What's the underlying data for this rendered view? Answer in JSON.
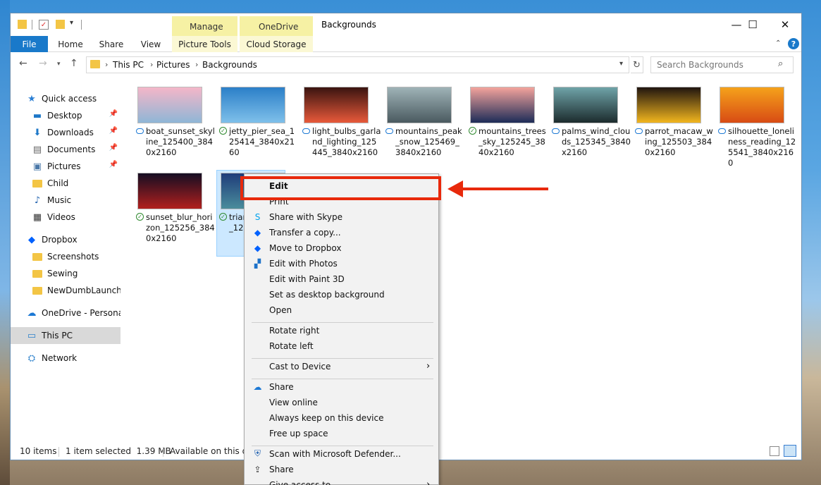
{
  "window": {
    "title": "Backgrounds",
    "min": "—",
    "max": "☐",
    "close": "✕"
  },
  "ribbon": {
    "contextual": [
      {
        "group": "Manage",
        "tab": "Picture Tools"
      },
      {
        "group": "OneDrive",
        "tab": "Cloud Storage"
      }
    ],
    "tabs": [
      "File",
      "Home",
      "Share",
      "View"
    ],
    "help": "?",
    "collapse": "⌃"
  },
  "address": {
    "crumbs": [
      "This PC",
      "Pictures",
      "Backgrounds"
    ],
    "search_placeholder": "Search Backgrounds"
  },
  "nav": [
    {
      "label": "Quick access",
      "icon": "star-icon",
      "pinned": false
    },
    {
      "label": "Desktop",
      "icon": "desktop-icon",
      "pinned": true
    },
    {
      "label": "Downloads",
      "icon": "download-icon",
      "pinned": true
    },
    {
      "label": "Documents",
      "icon": "document-icon",
      "pinned": true
    },
    {
      "label": "Pictures",
      "icon": "pictures-icon",
      "pinned": true
    },
    {
      "label": "Child",
      "icon": "folder-icon",
      "pinned": false
    },
    {
      "label": "Music",
      "icon": "music-icon",
      "pinned": false
    },
    {
      "label": "Videos",
      "icon": "video-icon",
      "pinned": false
    },
    {
      "label": "Dropbox",
      "icon": "dropbox-icon",
      "pinned": false
    },
    {
      "label": "Screenshots",
      "icon": "folder-icon",
      "pinned": false
    },
    {
      "label": "Sewing",
      "icon": "folder-icon",
      "pinned": false
    },
    {
      "label": "NewDumbLaunche",
      "icon": "folder-icon",
      "pinned": false
    },
    {
      "label": "OneDrive - Personal",
      "icon": "onedrive-icon",
      "pinned": false
    },
    {
      "label": "This PC",
      "icon": "pc-icon",
      "pinned": false
    },
    {
      "label": "Network",
      "icon": "network-icon",
      "pinned": false
    }
  ],
  "files": [
    {
      "name": "boat_sunset_skyline_125400_3840x2160",
      "status": "cloud",
      "colors": [
        "#f4b6c8",
        "#8fb6d6"
      ]
    },
    {
      "name": "jetty_pier_sea_125414_3840x2160",
      "status": "ok",
      "colors": [
        "#2b7fc8",
        "#7fc0ea"
      ]
    },
    {
      "name": "light_bulbs_garland_lighting_125445_3840x2160",
      "status": "cloud",
      "colors": [
        "#3a1410",
        "#e8593a"
      ]
    },
    {
      "name": "mountains_peak_snow_125469_3840x2160",
      "status": "cloud",
      "colors": [
        "#9fb3b7",
        "#4a5a60"
      ]
    },
    {
      "name": "mountains_trees_sky_125245_3840x2160",
      "status": "ok",
      "colors": [
        "#f4a39c",
        "#1d2c58"
      ]
    },
    {
      "name": "palms_wind_clouds_125345_3840x2160",
      "status": "cloud",
      "colors": [
        "#6fa3a8",
        "#1c2b2d"
      ]
    },
    {
      "name": "parrot_macaw_wing_125503_3840x2160",
      "status": "cloud",
      "colors": [
        "#20150f",
        "#f2b61e"
      ]
    },
    {
      "name": "silhouette_loneliness_reading_125541_3840x2160",
      "status": "cloud",
      "colors": [
        "#f5a21b",
        "#d84b14"
      ]
    },
    {
      "name": "sunset_blur_horizon_125256_3840x2160",
      "status": "ok",
      "colors": [
        "#150d22",
        "#b1201e"
      ]
    },
    {
      "name": "triangles_meteor_125_2160",
      "status": "ok",
      "colors": [
        "#1f3c7a",
        "#4a8d9c"
      ]
    }
  ],
  "status": {
    "count": "10 items",
    "selected": "1 item selected  1.39 MB",
    "availability": "Available on this dev"
  },
  "context_menu": [
    {
      "label": "Edit",
      "bold": true,
      "icon": ""
    },
    {
      "label": "Print",
      "icon": ""
    },
    {
      "label": "Share with Skype",
      "icon": "skype-icon"
    },
    {
      "label": "Transfer a copy...",
      "icon": "dropbox-icon"
    },
    {
      "label": "Move to Dropbox",
      "icon": "dropbox-icon"
    },
    {
      "label": "Edit with Photos",
      "icon": "photos-icon"
    },
    {
      "label": "Edit with Paint 3D",
      "icon": ""
    },
    {
      "label": "Set as desktop background",
      "icon": ""
    },
    {
      "label": "Open",
      "icon": ""
    },
    {
      "sep": true
    },
    {
      "label": "Rotate right",
      "icon": ""
    },
    {
      "label": "Rotate left",
      "icon": ""
    },
    {
      "sep": true
    },
    {
      "label": "Cast to Device",
      "icon": "",
      "submenu": true
    },
    {
      "sep": true
    },
    {
      "label": "Share",
      "icon": "onedrive-icon"
    },
    {
      "label": "View online",
      "icon": ""
    },
    {
      "label": "Always keep on this device",
      "icon": ""
    },
    {
      "label": "Free up space",
      "icon": ""
    },
    {
      "sep": true
    },
    {
      "label": "Scan with Microsoft Defender...",
      "icon": "defender-icon"
    },
    {
      "label": "Share",
      "icon": "share-icon"
    },
    {
      "label": "Give access to",
      "icon": "",
      "submenu": true
    }
  ],
  "accent": "#1979ca",
  "annotation_color": "#e8290b"
}
